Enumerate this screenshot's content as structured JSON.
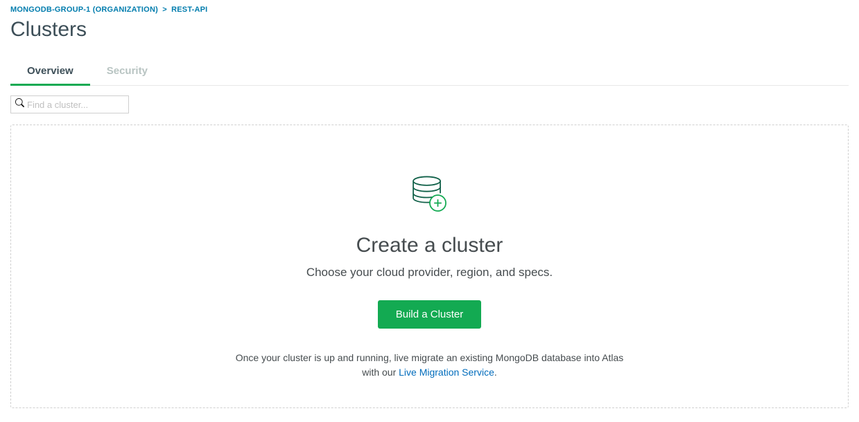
{
  "breadcrumb": {
    "org": "MONGODB-GROUP-1 (ORGANIZATION)",
    "sep": ">",
    "project": "REST-API"
  },
  "page_title": "Clusters",
  "tabs": {
    "overview": "Overview",
    "security": "Security"
  },
  "search": {
    "placeholder": "Find a cluster..."
  },
  "empty": {
    "heading": "Create a cluster",
    "sub": "Choose your cloud provider, region, and specs.",
    "button": "Build a Cluster",
    "footer_pre": "Once your cluster is up and running, live migrate an existing MongoDB database into Atlas with our ",
    "footer_link": "Live Migration Service",
    "footer_post": "."
  }
}
